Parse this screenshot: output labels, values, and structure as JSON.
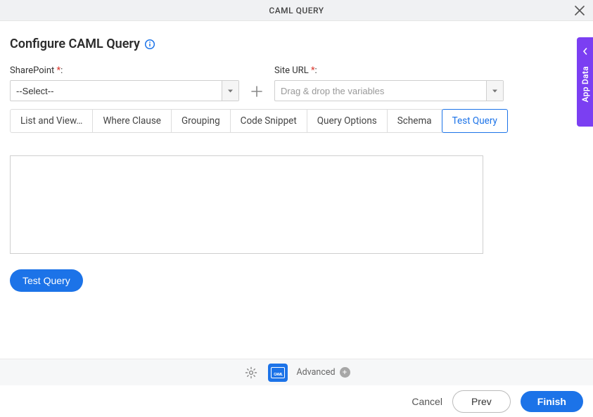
{
  "header": {
    "title": "CAML QUERY"
  },
  "page": {
    "title": "Configure CAML Query"
  },
  "fields": {
    "sharepoint": {
      "label": "SharePoint",
      "required_marker": "*",
      "value": "--Select--"
    },
    "siteurl": {
      "label": "Site URL",
      "required_marker": "*",
      "placeholder": "Drag & drop the variables"
    }
  },
  "tabs": [
    {
      "label": "List and View…",
      "active": false
    },
    {
      "label": "Where Clause",
      "active": false
    },
    {
      "label": "Grouping",
      "active": false
    },
    {
      "label": "Code Snippet",
      "active": false
    },
    {
      "label": "Query Options",
      "active": false
    },
    {
      "label": "Schema",
      "active": false
    },
    {
      "label": "Test Query",
      "active": true
    }
  ],
  "main": {
    "test_query_button": "Test Query",
    "query_text": ""
  },
  "sidebar": {
    "label": "App Data"
  },
  "footer": {
    "advanced_label": "Advanced",
    "cancel": "Cancel",
    "prev": "Prev",
    "finish": "Finish",
    "caml_badge": "CAML"
  }
}
